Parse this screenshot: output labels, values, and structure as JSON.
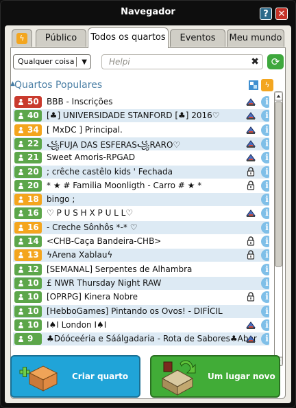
{
  "window": {
    "title": "Navegador",
    "help_label": "?",
    "close_label": "✕"
  },
  "tabs": [
    {
      "label": "Público"
    },
    {
      "label": "Todos os quartos"
    },
    {
      "label": "Eventos"
    },
    {
      "label": "Meu mundo"
    }
  ],
  "active_tab": "Todos os quartos",
  "filter": {
    "selected": "Qualquer coisa"
  },
  "search": {
    "placeholder": "Helpi"
  },
  "section": {
    "title": "Quartos Populares"
  },
  "rooms": [
    {
      "count": "50",
      "name": "BBB - Inscrições",
      "color": "red",
      "icon": "group-icon"
    },
    {
      "count": "40",
      "name": "[♣] UNIVERSIDADE STANFORD [♣] 2016♡",
      "color": "green",
      "icon": "group-icon"
    },
    {
      "count": "34",
      "name": "[ MxDC ] Principal.",
      "color": "orange",
      "icon": "group-icon"
    },
    {
      "count": "22",
      "name": "꧁FUJA DAS ESFERAS꧁RARO♡",
      "color": "green",
      "icon": "group-icon"
    },
    {
      "count": "21",
      "name": "Sweet Amoris-RPGAD",
      "color": "green",
      "icon": "group-icon"
    },
    {
      "count": "20",
      "name": "; crêche castêlo kids ' Fechada",
      "color": "green",
      "icon": "lock-icon"
    },
    {
      "count": "20",
      "name": "* ★ # Familia Moonligth - Carro # ★ *",
      "color": "green",
      "icon": "lock-icon"
    },
    {
      "count": "18",
      "name": "bingo ;",
      "color": "orange",
      "icon": ""
    },
    {
      "count": "16",
      "name": "♡ P U S H  X  P U L L♡",
      "color": "green",
      "icon": "group-icon"
    },
    {
      "count": "16",
      "name": " - Creche Sônhôs *-* ♡",
      "color": "orange",
      "icon": ""
    },
    {
      "count": "14",
      "name": "<CHB-Caça Bandeira-CHB>",
      "color": "green",
      "icon": "lock-icon"
    },
    {
      "count": "13",
      "name": "ϟArena Xablauϟ",
      "color": "orange",
      "icon": "lock-icon"
    },
    {
      "count": "12",
      "name": "[SEMANAL] Serpentes de Alhambra",
      "color": "green",
      "icon": ""
    },
    {
      "count": "10",
      "name": "£ NWR Thursday Night RAW",
      "color": "green",
      "icon": ""
    },
    {
      "count": "10",
      "name": "[OPRPG] Kinera Nobre",
      "color": "green",
      "icon": "lock-icon"
    },
    {
      "count": "10",
      "name": "[HebboGames] Pintando os Ovos! - DIFÍCIL",
      "color": "green",
      "icon": ""
    },
    {
      "count": "10",
      "name": "I♠I London I♠I",
      "color": "green",
      "icon": "group-icon"
    },
    {
      "count": "9",
      "name": "♣Dóóceéria e Sáálgadaria - Rota de Sabores♣Aber",
      "color": "green",
      "icon": "group-icon"
    }
  ],
  "buttons": {
    "create_room": "Criar quarto",
    "random_room": "Um lugar novo"
  },
  "colors": {
    "red": "#c93a2d",
    "orange": "#f4a51d",
    "green": "#5ca64a",
    "accent_blue": "#4b7fa5"
  }
}
